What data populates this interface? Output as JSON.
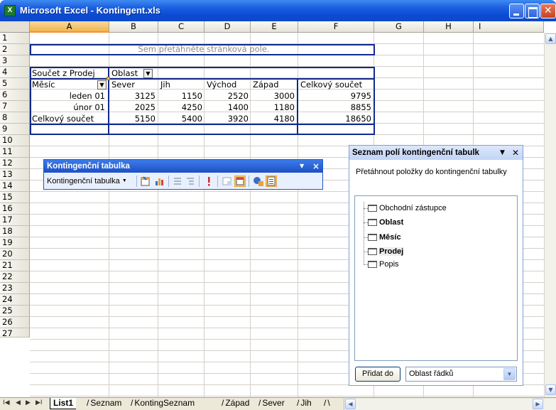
{
  "window": {
    "title": "Microsoft Excel - Kontingent.xls",
    "app_icon": "excel-icon"
  },
  "columns": [
    "A",
    "B",
    "C",
    "D",
    "E",
    "F",
    "G",
    "H",
    "I"
  ],
  "rows": [
    "1",
    "2",
    "3",
    "4",
    "5",
    "6",
    "7",
    "8",
    "9",
    "10",
    "11",
    "12",
    "13",
    "14",
    "15",
    "16",
    "17",
    "18",
    "19",
    "20",
    "21",
    "22",
    "23",
    "24",
    "25",
    "26",
    "27"
  ],
  "pivot": {
    "page_field_hint": "Sem přetáhněte stránková pole.",
    "data_label": "Součet z Prodej",
    "column_field": "Oblast",
    "row_field": "Měsíc",
    "column_items": [
      "Sever",
      "Jih",
      "Východ",
      "Západ",
      "Celkový součet"
    ],
    "row_items": [
      {
        "label": "leden 01",
        "values": [
          "3125",
          "1150",
          "2520",
          "3000",
          "9795"
        ]
      },
      {
        "label": "únor 01",
        "values": [
          "2025",
          "4250",
          "1400",
          "1180",
          "8855"
        ]
      }
    ],
    "grand_total": {
      "label": "Celkový součet",
      "values": [
        "5150",
        "5400",
        "3920",
        "4180",
        "18650"
      ]
    }
  },
  "toolbar": {
    "title": "Kontingenční tabulka",
    "menu_label": "Kontingenční tabulka"
  },
  "task_pane": {
    "title": "Seznam polí kontingenční tabulk",
    "description": "Přetáhnout položky do kontingenční tabulky",
    "fields": [
      "Obchodní zástupce",
      "Oblast",
      "Měsíc",
      "Prodej",
      "Popis"
    ],
    "add_button": "Přidat do",
    "area_selected": "Oblast řádků"
  },
  "sheets": [
    "List1",
    "Seznam",
    "KontingSeznam",
    "Západ",
    "Sever",
    "Jih",
    "\\"
  ]
}
